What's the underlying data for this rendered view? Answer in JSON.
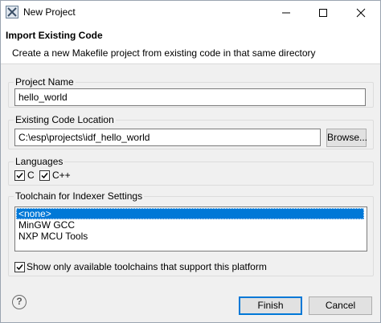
{
  "window": {
    "title": "New Project"
  },
  "header": {
    "title": "Import Existing Code",
    "description": "Create a new Makefile project from existing code in that same directory"
  },
  "project_name": {
    "label": "Project Name",
    "value": "hello_world"
  },
  "code_location": {
    "label": "Existing Code Location",
    "value": "C:\\esp\\projects\\idf_hello_world",
    "browse_label": "Browse..."
  },
  "languages": {
    "label": "Languages",
    "items": [
      {
        "label": "C",
        "checked": true
      },
      {
        "label": "C++",
        "checked": true
      }
    ]
  },
  "toolchain": {
    "label": "Toolchain for Indexer Settings",
    "items": [
      "<none>",
      "MinGW GCC",
      "NXP MCU Tools"
    ],
    "selected_index": 0,
    "filter_label": "Show only available toolchains that support this platform",
    "filter_checked": true
  },
  "footer": {
    "finish_label": "Finish",
    "cancel_label": "Cancel",
    "help_symbol": "?"
  },
  "colors": {
    "selection": "#0078d7",
    "window_bg": "#f0f0f0"
  },
  "icons": [
    "app-icon",
    "minimize-icon",
    "maximize-icon",
    "close-icon",
    "help-icon",
    "checkmark-icon"
  ]
}
